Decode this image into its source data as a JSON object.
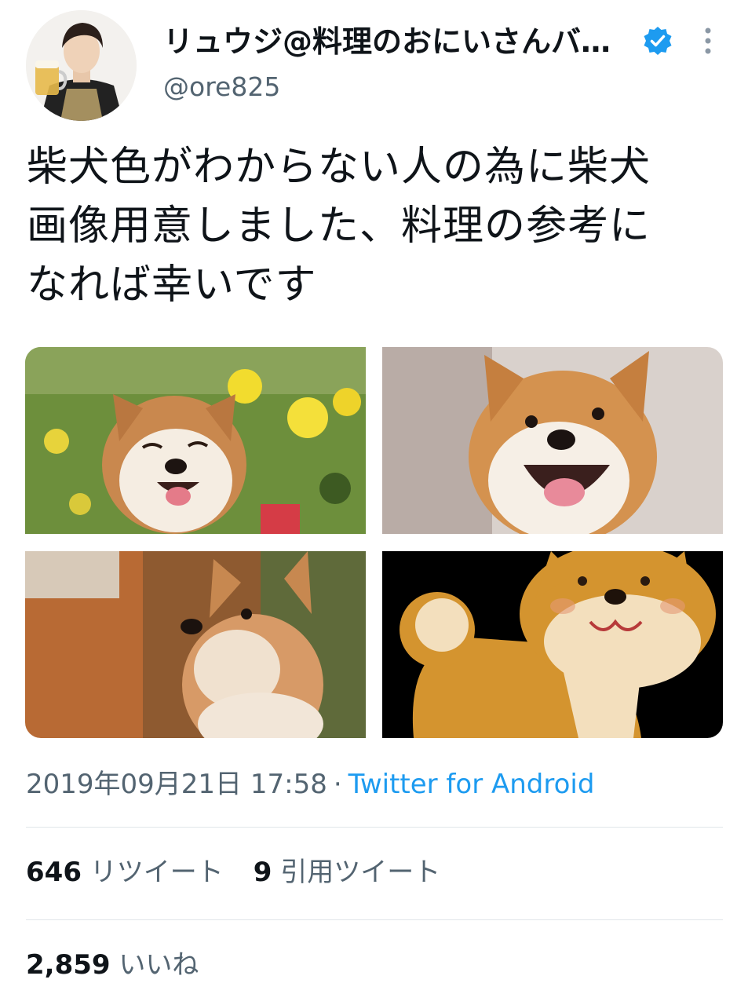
{
  "author": {
    "display_name": "リュウジ@料理のおにいさんバ…",
    "handle": "@ore825",
    "verified_icon": "verified-badge-icon",
    "verified_color": "#1d9bf0",
    "more_icon": "more-vertical-icon"
  },
  "tweet": {
    "text": "柴犬色がわからない人の為に柴犬\n画像用意しました、料理の参考に\nなれば幸いです",
    "media_count": 4
  },
  "meta": {
    "timestamp": "2019年09月21日 17:58",
    "separator": "·",
    "source": "Twitter for Android"
  },
  "stats": {
    "retweets_count": "646",
    "retweets_label": "リツイート",
    "quotes_count": "9",
    "quotes_label": "引用ツイート",
    "likes_count": "2,859",
    "likes_label": "いいね"
  },
  "colors": {
    "text": "#0f1419",
    "secondary": "#536471",
    "link": "#1d9bf0",
    "divider": "#e1e6ea"
  }
}
